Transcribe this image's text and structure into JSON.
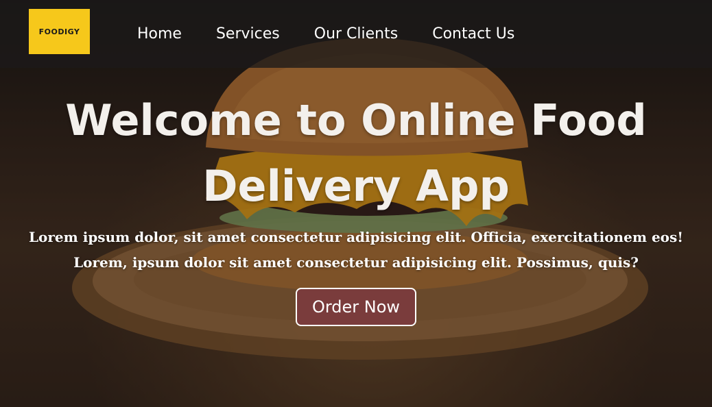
{
  "brand": {
    "logo_text": "FOODIGY",
    "logo_color": "#f6c81b"
  },
  "nav": {
    "items": [
      {
        "label": "Home"
      },
      {
        "label": "Services"
      },
      {
        "label": "Our Clients"
      },
      {
        "label": "Contact Us"
      }
    ]
  },
  "hero": {
    "title": "Welcome to Online Food Delivery App",
    "description": "Lorem ipsum dolor, sit amet consectetur adipisicing elit. Officia, exercitationem eos! Lorem, ipsum dolor sit amet consectetur adipisicing elit. Possimus, quis?",
    "cta_label": "Order Now",
    "cta_color": "#7a3c3c"
  }
}
